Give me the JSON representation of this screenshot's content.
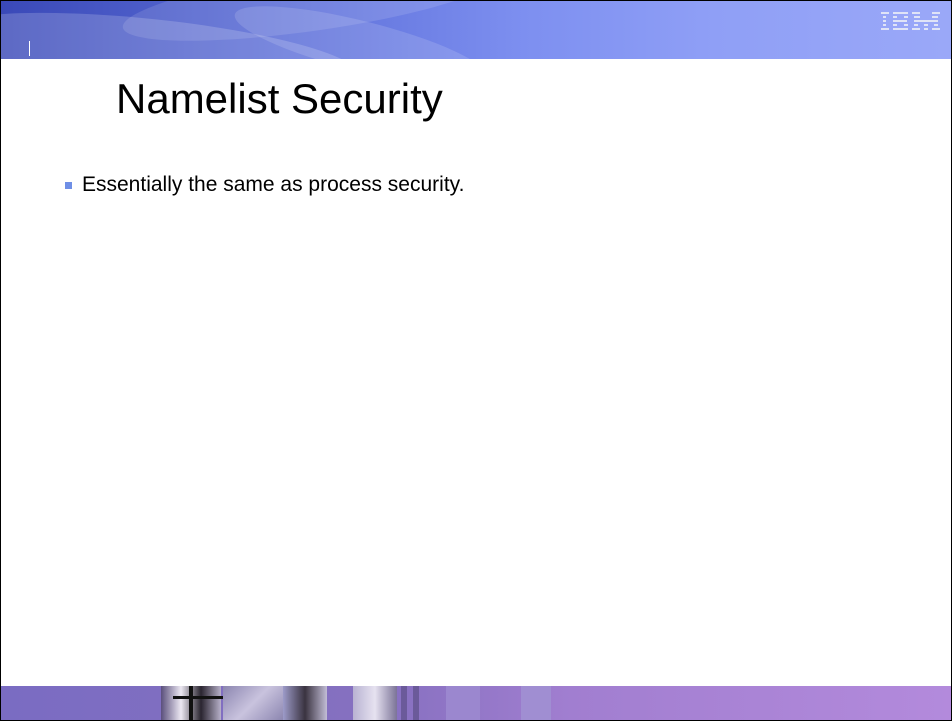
{
  "slide": {
    "title": "Namelist Security",
    "bullets": [
      "Essentially the same as process security."
    ]
  },
  "branding": {
    "logo_text": "IBM",
    "logo_icon": "ibm-logo-icon"
  },
  "colors": {
    "header_band": "#5d6fd8",
    "bottom_band": "#8670c0",
    "bullet_marker": "#6f8fe6",
    "logo": "#d8dcf4"
  }
}
